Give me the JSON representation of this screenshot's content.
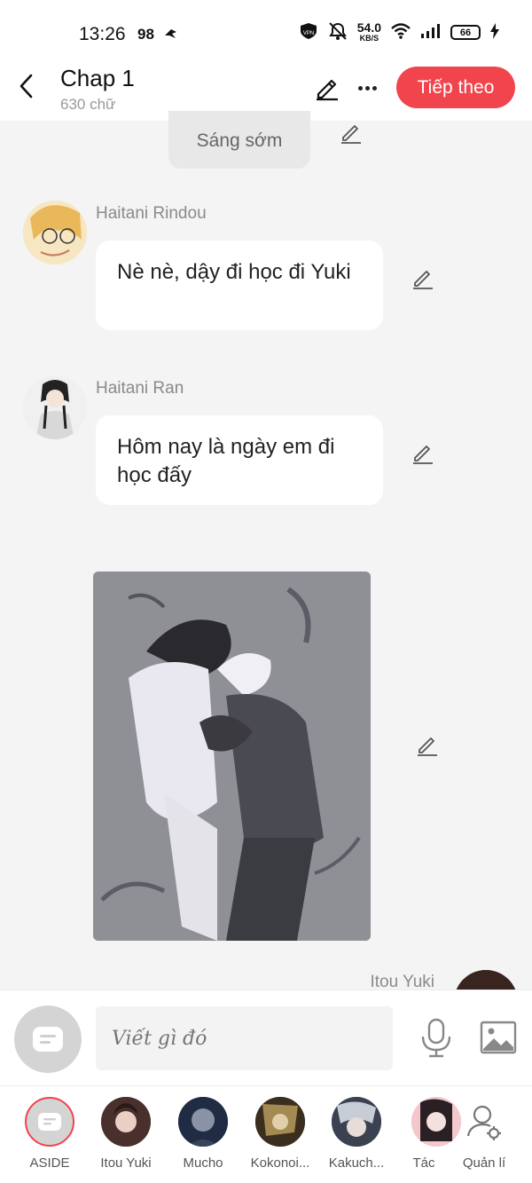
{
  "status_bar": {
    "time": "13:26",
    "notif_count": "98",
    "speed_value": "54.0",
    "speed_unit": "KB/S",
    "battery": "66"
  },
  "header": {
    "title": "Chap 1",
    "subtitle": "630 chữ",
    "next_label": "Tiếp theo",
    "accent": "#f2444d"
  },
  "chat": {
    "scene_label": "Sáng sớm",
    "messages": [
      {
        "speaker": "Haitani Rindou",
        "text": "Nè nè, dậy đi học đi Yuki"
      },
      {
        "speaker": "Haitani Ran",
        "text": "Hôm nay là ngày em đi học đấy"
      }
    ],
    "next_speaker": "Itou Yuki"
  },
  "composer": {
    "placeholder": "Viết gì đó"
  },
  "characters": [
    {
      "label": "ASIDE"
    },
    {
      "label": "Itou Yuki"
    },
    {
      "label": "Mucho"
    },
    {
      "label": "Kokonoi..."
    },
    {
      "label": "Kakuch..."
    },
    {
      "label": "Tác"
    },
    {
      "label": "Quản lí"
    }
  ]
}
